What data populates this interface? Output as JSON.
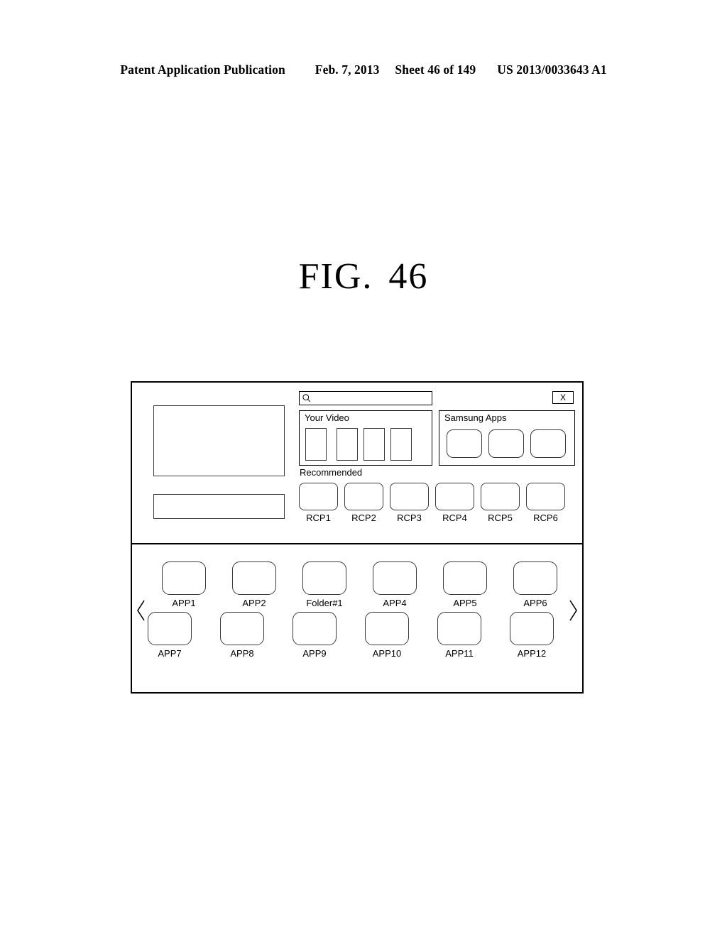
{
  "page_header": {
    "publication": "Patent Application Publication",
    "date": "Feb. 7, 2013",
    "sheet": "Sheet 46 of 149",
    "publication_number": "US 2013/0033643 A1"
  },
  "figure": {
    "label": "FIG.",
    "number": "46"
  },
  "ui": {
    "search": {
      "icon": "search-icon",
      "value": "",
      "placeholder": ""
    },
    "close_button": {
      "label": "X",
      "icon": "close-icon"
    },
    "preview": {
      "main_box_label": "",
      "info_bar_label": ""
    },
    "panels": [
      {
        "id": "your-video",
        "title": "Your Video",
        "thumbnails": [
          "",
          "",
          "",
          ""
        ]
      },
      {
        "id": "samsung-apps",
        "title": "Samsung Apps",
        "tiles": [
          "",
          "",
          ""
        ]
      }
    ],
    "recommended": {
      "title": "Recommended",
      "items": [
        {
          "label": "RCP1"
        },
        {
          "label": "RCP2"
        },
        {
          "label": "RCP3"
        },
        {
          "label": "RCP4"
        },
        {
          "label": "RCP5"
        },
        {
          "label": "RCP6"
        }
      ]
    },
    "app_grid": {
      "prev_arrow": "‹",
      "next_arrow": "›",
      "row1": [
        {
          "label": "APP1"
        },
        {
          "label": "APP2"
        },
        {
          "label": "Folder#1"
        },
        {
          "label": "APP4"
        },
        {
          "label": "APP5"
        },
        {
          "label": "APP6"
        }
      ],
      "row2": [
        {
          "label": "APP7"
        },
        {
          "label": "APP8"
        },
        {
          "label": "APP9"
        },
        {
          "label": "APP10"
        },
        {
          "label": "APP11"
        },
        {
          "label": "APP12"
        }
      ]
    }
  },
  "colors": {
    "line": "#000000",
    "line_soft": "#3a3a3a",
    "background": "#ffffff"
  }
}
